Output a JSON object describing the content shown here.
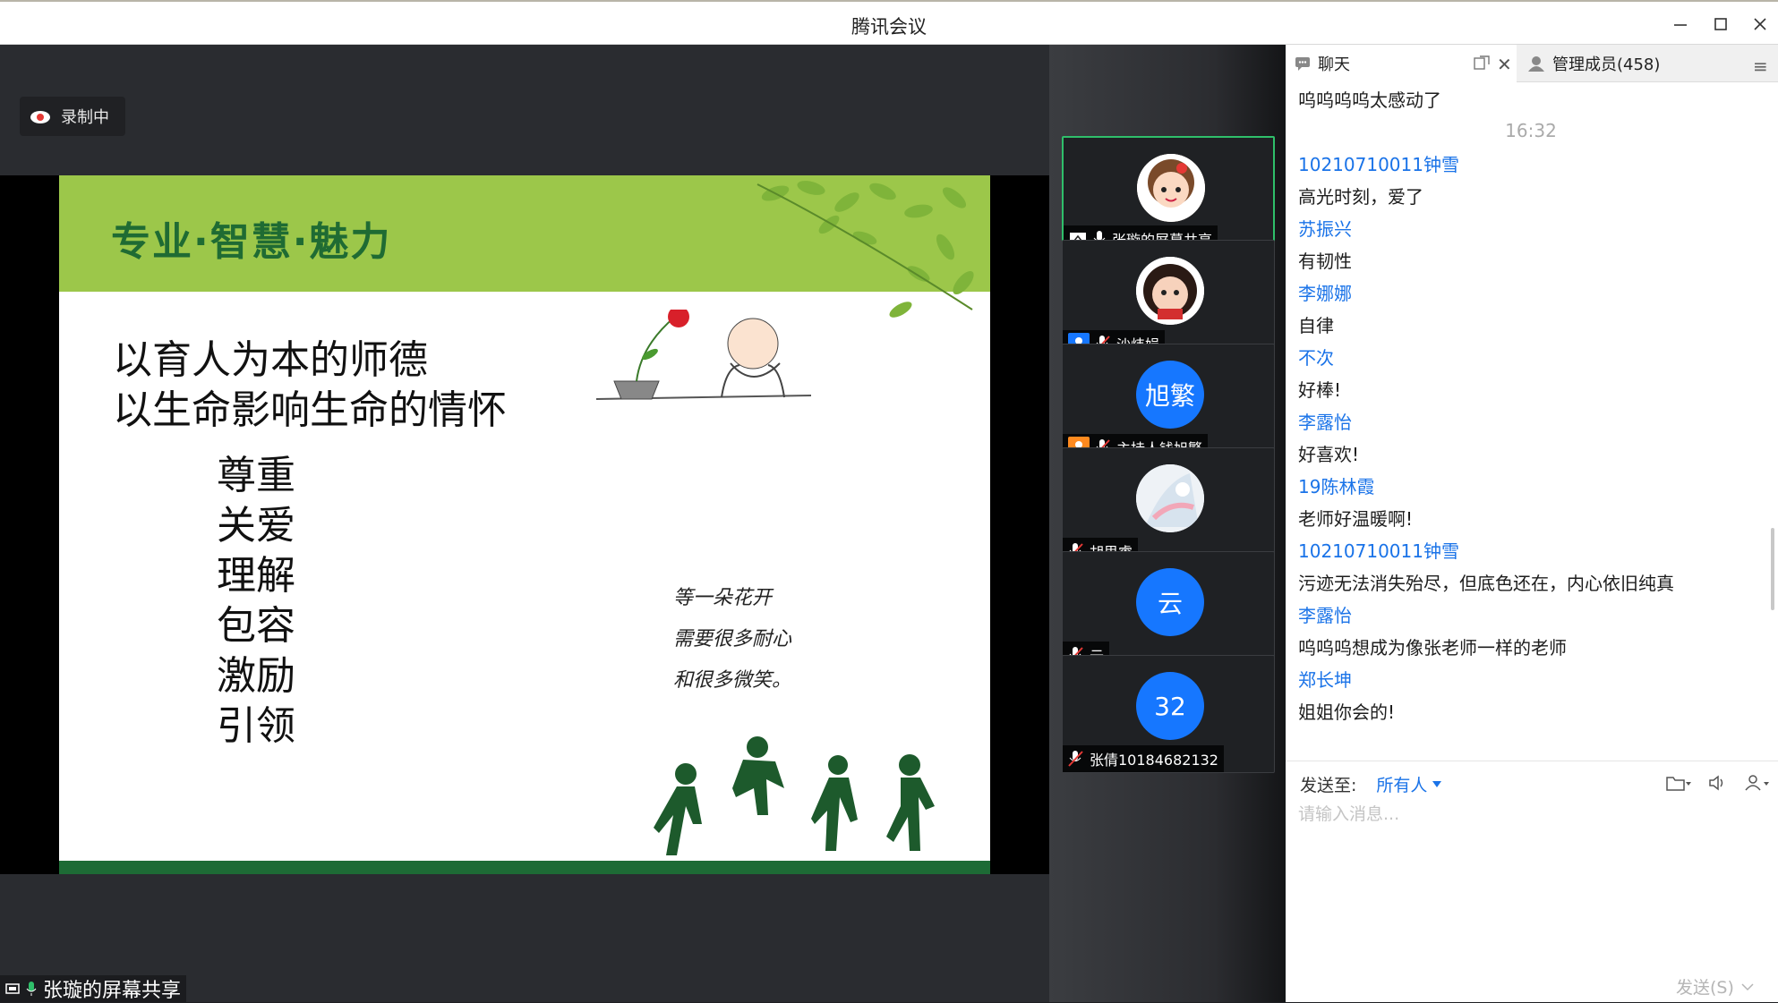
{
  "window": {
    "title": "腾讯会议"
  },
  "recording": {
    "label": "录制中"
  },
  "slide": {
    "header_title": "专业·智慧·魅力",
    "line1": "以育人为本的师德",
    "line2": "以生命影响生命的情怀",
    "virtues": [
      "尊重",
      "关爱",
      "理解",
      "包容",
      "激励",
      "引领"
    ],
    "caption": [
      "等一朵花开",
      "需要很多耐心",
      "和很多微笑。"
    ]
  },
  "screen_share": {
    "label": "张璇的屏幕共享"
  },
  "participants": [
    {
      "name": "张璇的屏幕共享",
      "avatar_type": "cartoon-girl"
    },
    {
      "name": "沙炜娟",
      "avatar_type": "cartoon-face"
    },
    {
      "name": "主持人钱旭繁",
      "avatar_text": "旭繁"
    },
    {
      "name": "胡思睿",
      "avatar_type": "photo"
    },
    {
      "name": "云",
      "avatar_text": "云"
    },
    {
      "name": "张倩10184682132",
      "avatar_text": "32"
    }
  ],
  "panel": {
    "tab_chat": "聊天",
    "tab_members": "管理成员(458)"
  },
  "chat": [
    {
      "kind": "text",
      "text": "呜呜呜呜太感动了"
    },
    {
      "kind": "time",
      "text": "16:32"
    },
    {
      "kind": "sender",
      "text": "10210710011钟雪"
    },
    {
      "kind": "text",
      "text": "高光时刻，爱了"
    },
    {
      "kind": "sender",
      "text": "苏振兴"
    },
    {
      "kind": "text",
      "text": "有韧性"
    },
    {
      "kind": "sender",
      "text": "李娜娜"
    },
    {
      "kind": "text",
      "text": "自律"
    },
    {
      "kind": "sender",
      "text": "不次"
    },
    {
      "kind": "text",
      "text": "好棒!"
    },
    {
      "kind": "sender",
      "text": "李露怡"
    },
    {
      "kind": "text",
      "text": "好喜欢!"
    },
    {
      "kind": "sender",
      "text": "19陈林霞"
    },
    {
      "kind": "text",
      "text": "老师好温暖啊!"
    },
    {
      "kind": "sender",
      "text": "10210710011钟雪"
    },
    {
      "kind": "text",
      "text": "污迹无法消失殆尽，但底色还在，内心依旧纯真"
    },
    {
      "kind": "sender",
      "text": "李露怡"
    },
    {
      "kind": "text",
      "text": "呜呜呜想成为像张老师一样的老师"
    },
    {
      "kind": "sender",
      "text": "郑长坤"
    },
    {
      "kind": "text",
      "text": "姐姐你会的!"
    }
  ],
  "composer": {
    "sendto_label": "发送至:",
    "sendto_target": "所有人",
    "placeholder": "请输入消息...",
    "send_label": "发送(S)"
  },
  "colors": {
    "accent": "#1a73e8",
    "slide_green": "#9cc74a",
    "active_border": "#2fbf6a",
    "avatar_blue": "#1677ff"
  }
}
